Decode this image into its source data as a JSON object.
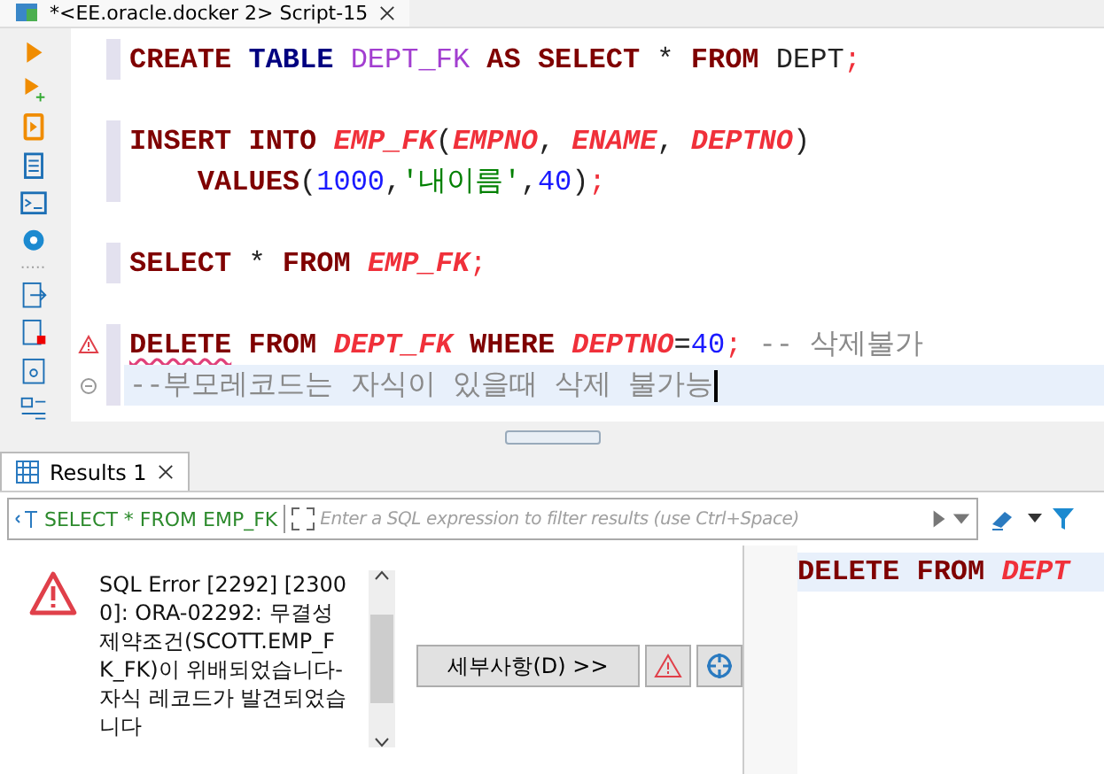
{
  "editor_tab": {
    "title": "*<EE.oracle.docker 2> Script-15",
    "dirty": true
  },
  "statements": [
    {
      "lines": [
        {
          "warning": false,
          "current": false,
          "tokens": [
            {
              "t": "CREATE ",
              "kind": "kw"
            },
            {
              "t": "TABLE ",
              "kind": "kw2"
            },
            {
              "t": "DEPT_FK ",
              "kind": "newtbl"
            },
            {
              "t": "AS ",
              "kind": "kw"
            },
            {
              "t": "SELECT ",
              "kind": "kw"
            },
            {
              "t": "* ",
              "kind": "plain"
            },
            {
              "t": "FROM ",
              "kind": "kw"
            },
            {
              "t": "DEPT",
              "kind": "plain"
            },
            {
              "t": ";",
              "kind": "semi"
            }
          ]
        }
      ]
    },
    {
      "lines": [
        {
          "warning": false,
          "current": false,
          "tokens": [
            {
              "t": "INSERT ",
              "kind": "kw"
            },
            {
              "t": "INTO ",
              "kind": "kw"
            },
            {
              "t": "EMP_FK",
              "kind": "tbl"
            },
            {
              "t": "(",
              "kind": "plain"
            },
            {
              "t": "EMPNO",
              "kind": "tbl"
            },
            {
              "t": ", ",
              "kind": "plain"
            },
            {
              "t": "ENAME",
              "kind": "tbl"
            },
            {
              "t": ", ",
              "kind": "plain"
            },
            {
              "t": "DEPTNO",
              "kind": "tbl"
            },
            {
              "t": ")",
              "kind": "plain"
            }
          ]
        },
        {
          "warning": false,
          "current": false,
          "tokens": [
            {
              "t": "    VALUES",
              "kind": "kw"
            },
            {
              "t": "(",
              "kind": "plain"
            },
            {
              "t": "1000",
              "kind": "num"
            },
            {
              "t": ",",
              "kind": "plain"
            },
            {
              "t": "'내이름'",
              "kind": "str"
            },
            {
              "t": ",",
              "kind": "plain"
            },
            {
              "t": "40",
              "kind": "num"
            },
            {
              "t": ")",
              "kind": "plain"
            },
            {
              "t": ";",
              "kind": "semi"
            }
          ]
        }
      ]
    },
    {
      "lines": [
        {
          "warning": false,
          "current": false,
          "tokens": [
            {
              "t": "SELECT ",
              "kind": "kw"
            },
            {
              "t": "* ",
              "kind": "plain"
            },
            {
              "t": "FROM ",
              "kind": "kw"
            },
            {
              "t": "EMP_FK",
              "kind": "tbl"
            },
            {
              "t": ";",
              "kind": "semi"
            }
          ]
        }
      ]
    },
    {
      "lines": [
        {
          "warning": true,
          "current": false,
          "tokens": [
            {
              "t": "DELETE",
              "kind": "kw",
              "error": true
            },
            {
              "t": " FROM ",
              "kind": "kw"
            },
            {
              "t": "DEPT_FK ",
              "kind": "tbl"
            },
            {
              "t": "WHERE ",
              "kind": "kw"
            },
            {
              "t": "DEPTNO",
              "kind": "tbl"
            },
            {
              "t": "=",
              "kind": "plain"
            },
            {
              "t": "40",
              "kind": "num"
            },
            {
              "t": ";",
              "kind": "semi"
            },
            {
              "t": " -- 삭제불가",
              "kind": "comment"
            }
          ]
        },
        {
          "warning": false,
          "current": true,
          "tokens": [
            {
              "t": "--부모레코드는 자식이 있을때 삭제 불가능",
              "kind": "comment"
            }
          ]
        }
      ]
    }
  ],
  "results_tab": {
    "label": "Results 1",
    "selected": true
  },
  "filter_bar": {
    "query": "SELECT * FROM EMP_FK",
    "placeholder": "Enter a SQL expression to filter results (use Ctrl+Space)"
  },
  "error": {
    "message": "SQL Error [2292] [23000]: ORA-02292: 무결성 제약조건(SCOTT.EMP_FK_FK)이 위배되었습니다- 자식 레코드가 발견되었습니다",
    "details_button": "세부사항(D) >>"
  },
  "query_preview": {
    "tokens": [
      {
        "t": "DELETE ",
        "kind": "kw"
      },
      {
        "t": "FROM ",
        "kind": "kw"
      },
      {
        "t": "DEPT",
        "kind": "tbl"
      }
    ]
  }
}
